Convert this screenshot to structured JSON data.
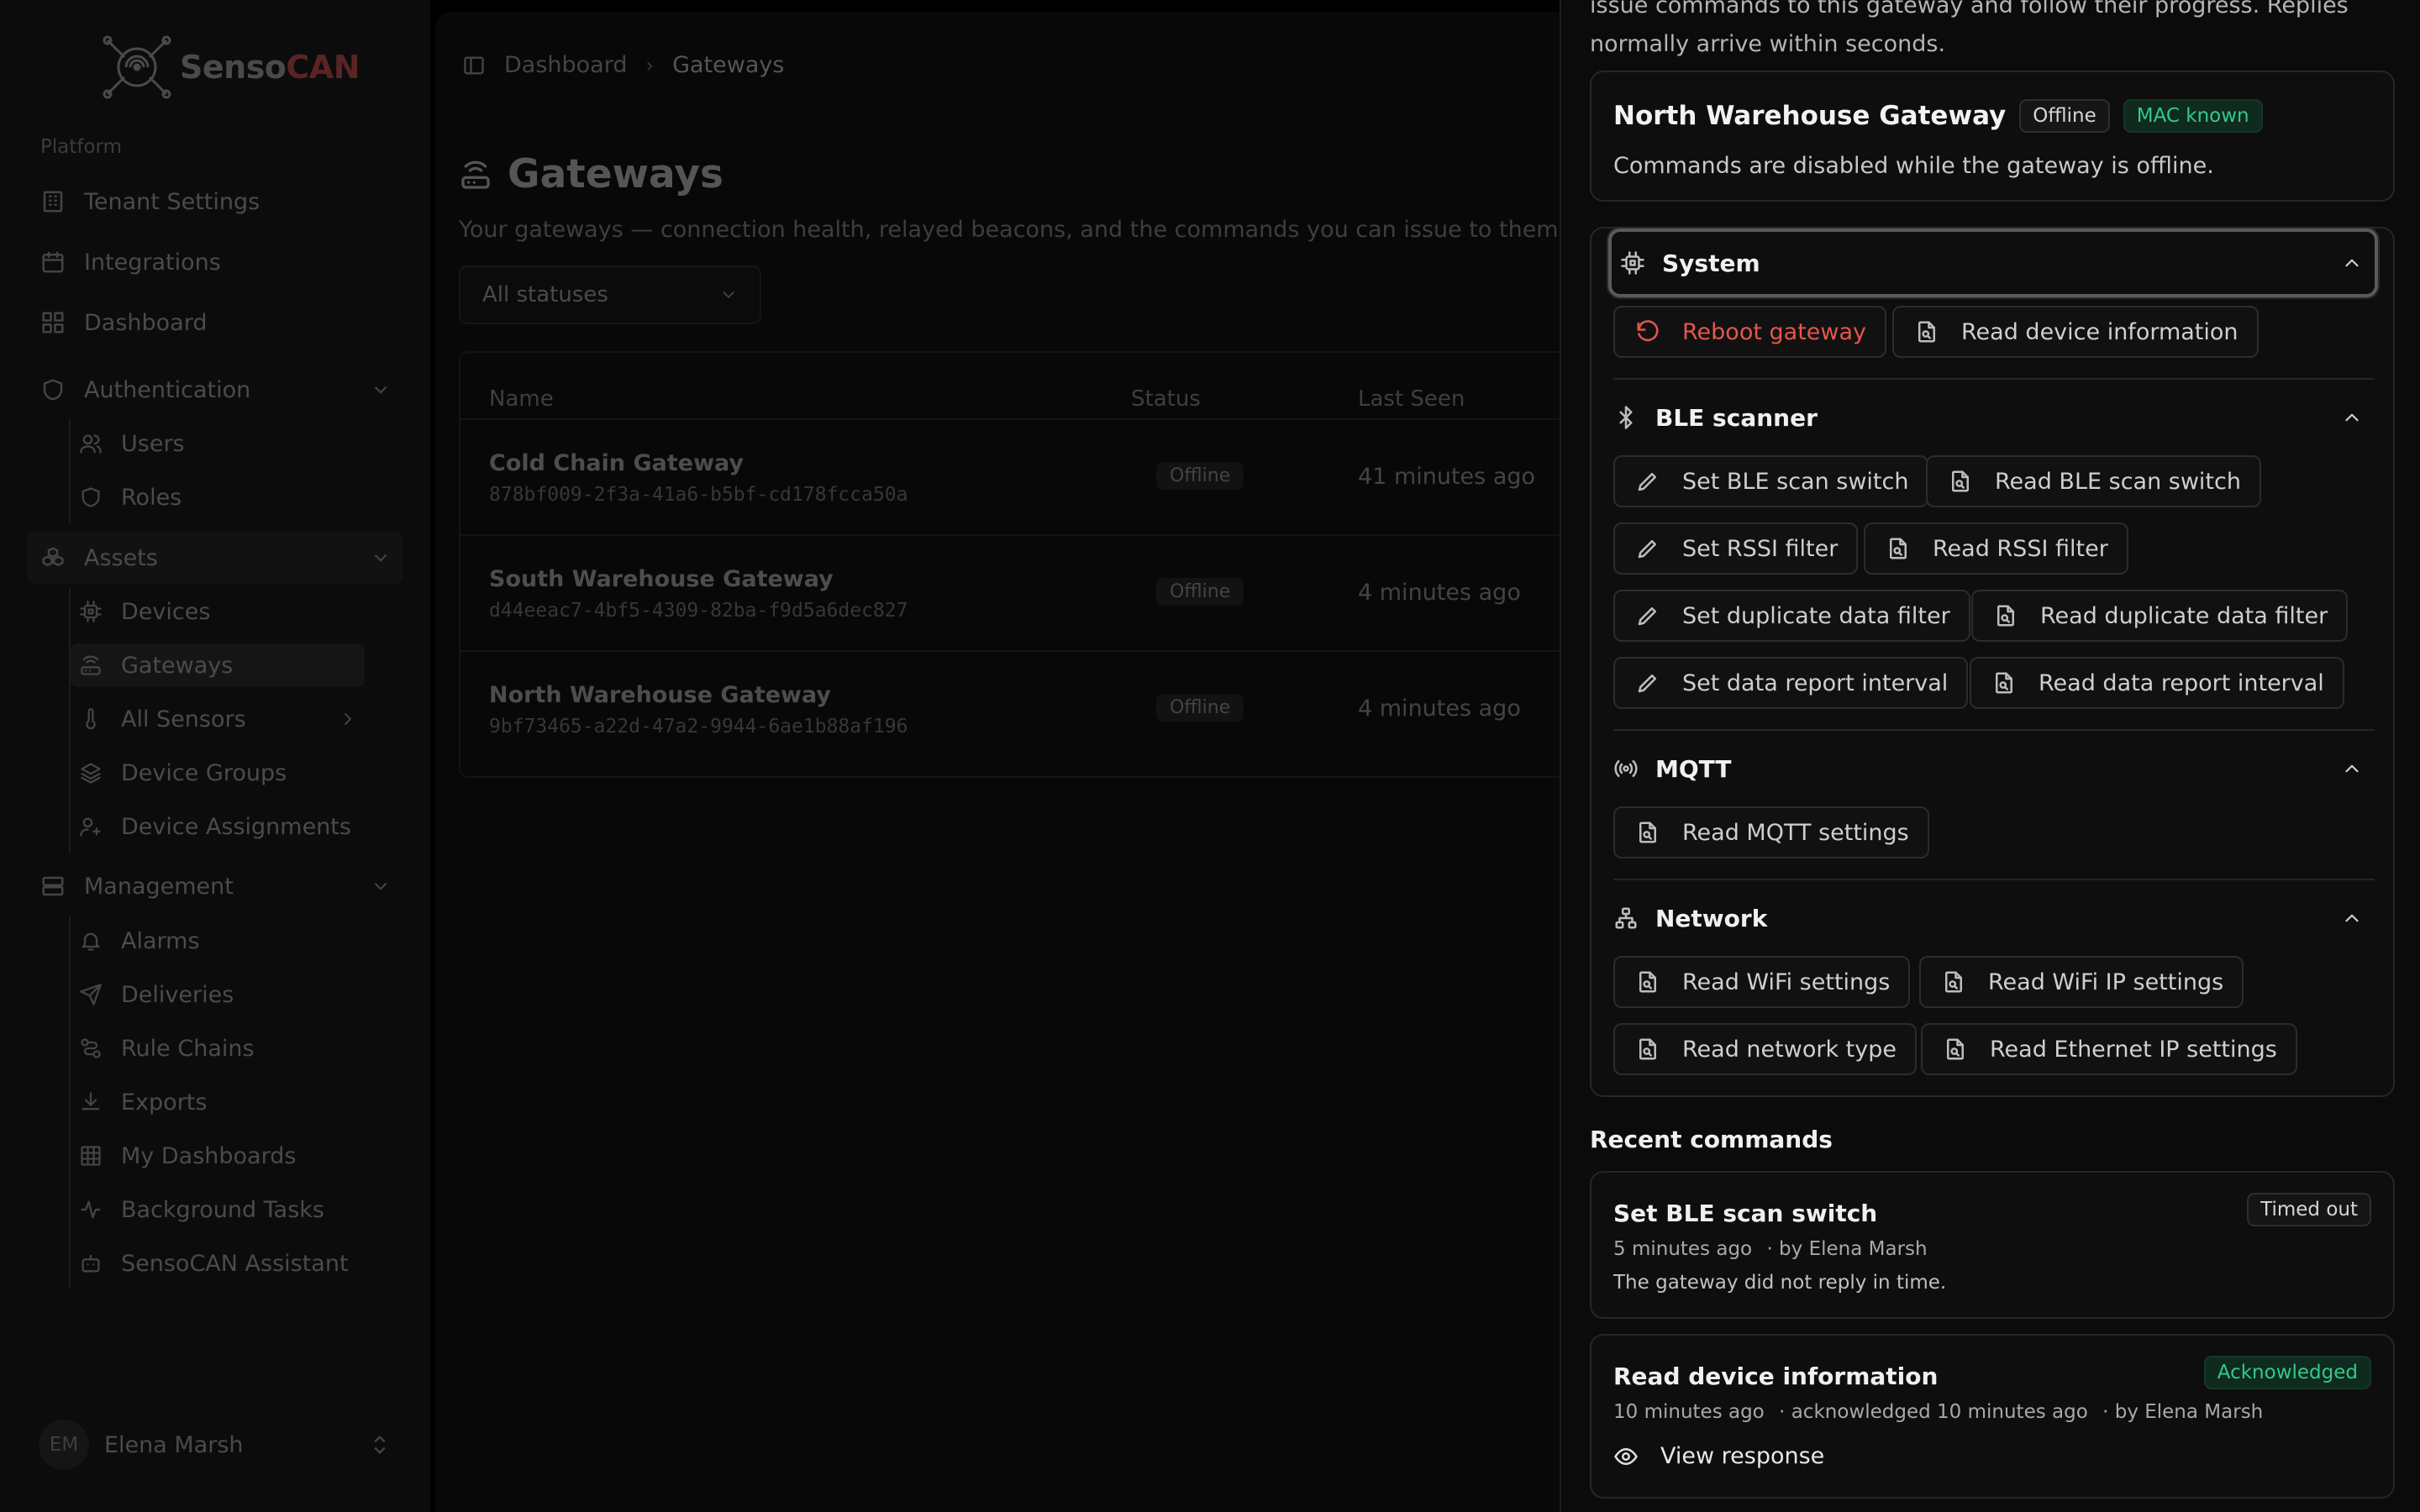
{
  "app": {
    "brand_prefix": "Senso",
    "brand_suffix": "CAN"
  },
  "sidebar": {
    "section_label": "Platform",
    "top_items": [
      {
        "label": "Tenant Settings",
        "icon": "building-icon"
      },
      {
        "label": "Integrations",
        "icon": "calendar-icon"
      },
      {
        "label": "Dashboard",
        "icon": "grid-icon"
      }
    ],
    "authentication": {
      "label": "Authentication",
      "icon": "shield-icon",
      "children": [
        "Users",
        "Roles"
      ]
    },
    "assets": {
      "label": "Assets",
      "icon": "boxes-icon",
      "children": [
        "Devices",
        "Gateways",
        "All Sensors",
        "Device Groups",
        "Device Assignments"
      ]
    },
    "management": {
      "label": "Management",
      "icon": "server-icon",
      "children": [
        "Alarms",
        "Deliveries",
        "Rule Chains",
        "Exports",
        "My Dashboards",
        "Background Tasks",
        "SensoCAN Assistant"
      ]
    },
    "user": {
      "initials": "EM",
      "name": "Elena Marsh"
    }
  },
  "breadcrumb": {
    "home": "Dashboard",
    "current": "Gateways"
  },
  "page": {
    "title": "Gateways",
    "subtitle": "Your gateways — connection health, relayed beacons, and the commands you can issue to them.",
    "filter": "All statuses"
  },
  "table": {
    "columns": [
      "Name",
      "Status",
      "Last Seen"
    ],
    "rows": [
      {
        "name": "Cold Chain Gateway",
        "id": "878bf009-2f3a-41a6-b5bf-cd178fcca50a",
        "status": "Offline",
        "last_seen": "41 minutes ago"
      },
      {
        "name": "South Warehouse Gateway",
        "id": "d44eeac7-4bf5-4309-82ba-f9d5a6dec827",
        "status": "Offline",
        "last_seen": "4 minutes ago"
      },
      {
        "name": "North Warehouse Gateway",
        "id": "9bf73465-a22d-47a2-9944-6ae1b88af196",
        "status": "Offline",
        "last_seen": "4 minutes ago"
      }
    ]
  },
  "drawer": {
    "intro_line1": "issue commands to this gateway and follow their progress. Replies",
    "intro_line2": "normally arrive within seconds.",
    "gateway": {
      "name": "North Warehouse Gateway",
      "status_badge": "Offline",
      "mac_badge": "MAC known",
      "note": "Commands are disabled while the gateway is offline."
    },
    "sections": {
      "system": {
        "title": "System",
        "buttons": [
          "Reboot gateway",
          "Read device information"
        ]
      },
      "ble": {
        "title": "BLE scanner",
        "buttons": [
          "Set BLE scan switch",
          "Read BLE scan switch",
          "Set RSSI filter",
          "Read RSSI filter",
          "Set duplicate data filter",
          "Read duplicate data filter",
          "Set data report interval",
          "Read data report interval"
        ]
      },
      "mqtt": {
        "title": "MQTT",
        "buttons": [
          "Read MQTT settings"
        ]
      },
      "network": {
        "title": "Network",
        "buttons": [
          "Read WiFi settings",
          "Read WiFi IP settings",
          "Read network type",
          "Read Ethernet IP settings"
        ]
      }
    },
    "recent": {
      "title": "Recent commands",
      "items": [
        {
          "title": "Set BLE scan switch",
          "badge": "Timed out",
          "when": "5 minutes ago",
          "by": "· by Elena Marsh",
          "note": "The gateway did not reply in time."
        },
        {
          "title": "Read device information",
          "badge": "Acknowledged",
          "when": "10 minutes ago",
          "ack": "· acknowledged 10 minutes ago",
          "by": "· by Elena Marsh",
          "link": "View response"
        }
      ]
    }
  },
  "colors": {
    "danger": "#e2574c",
    "success": "#34c98a",
    "brand_red": "#c0392b"
  }
}
